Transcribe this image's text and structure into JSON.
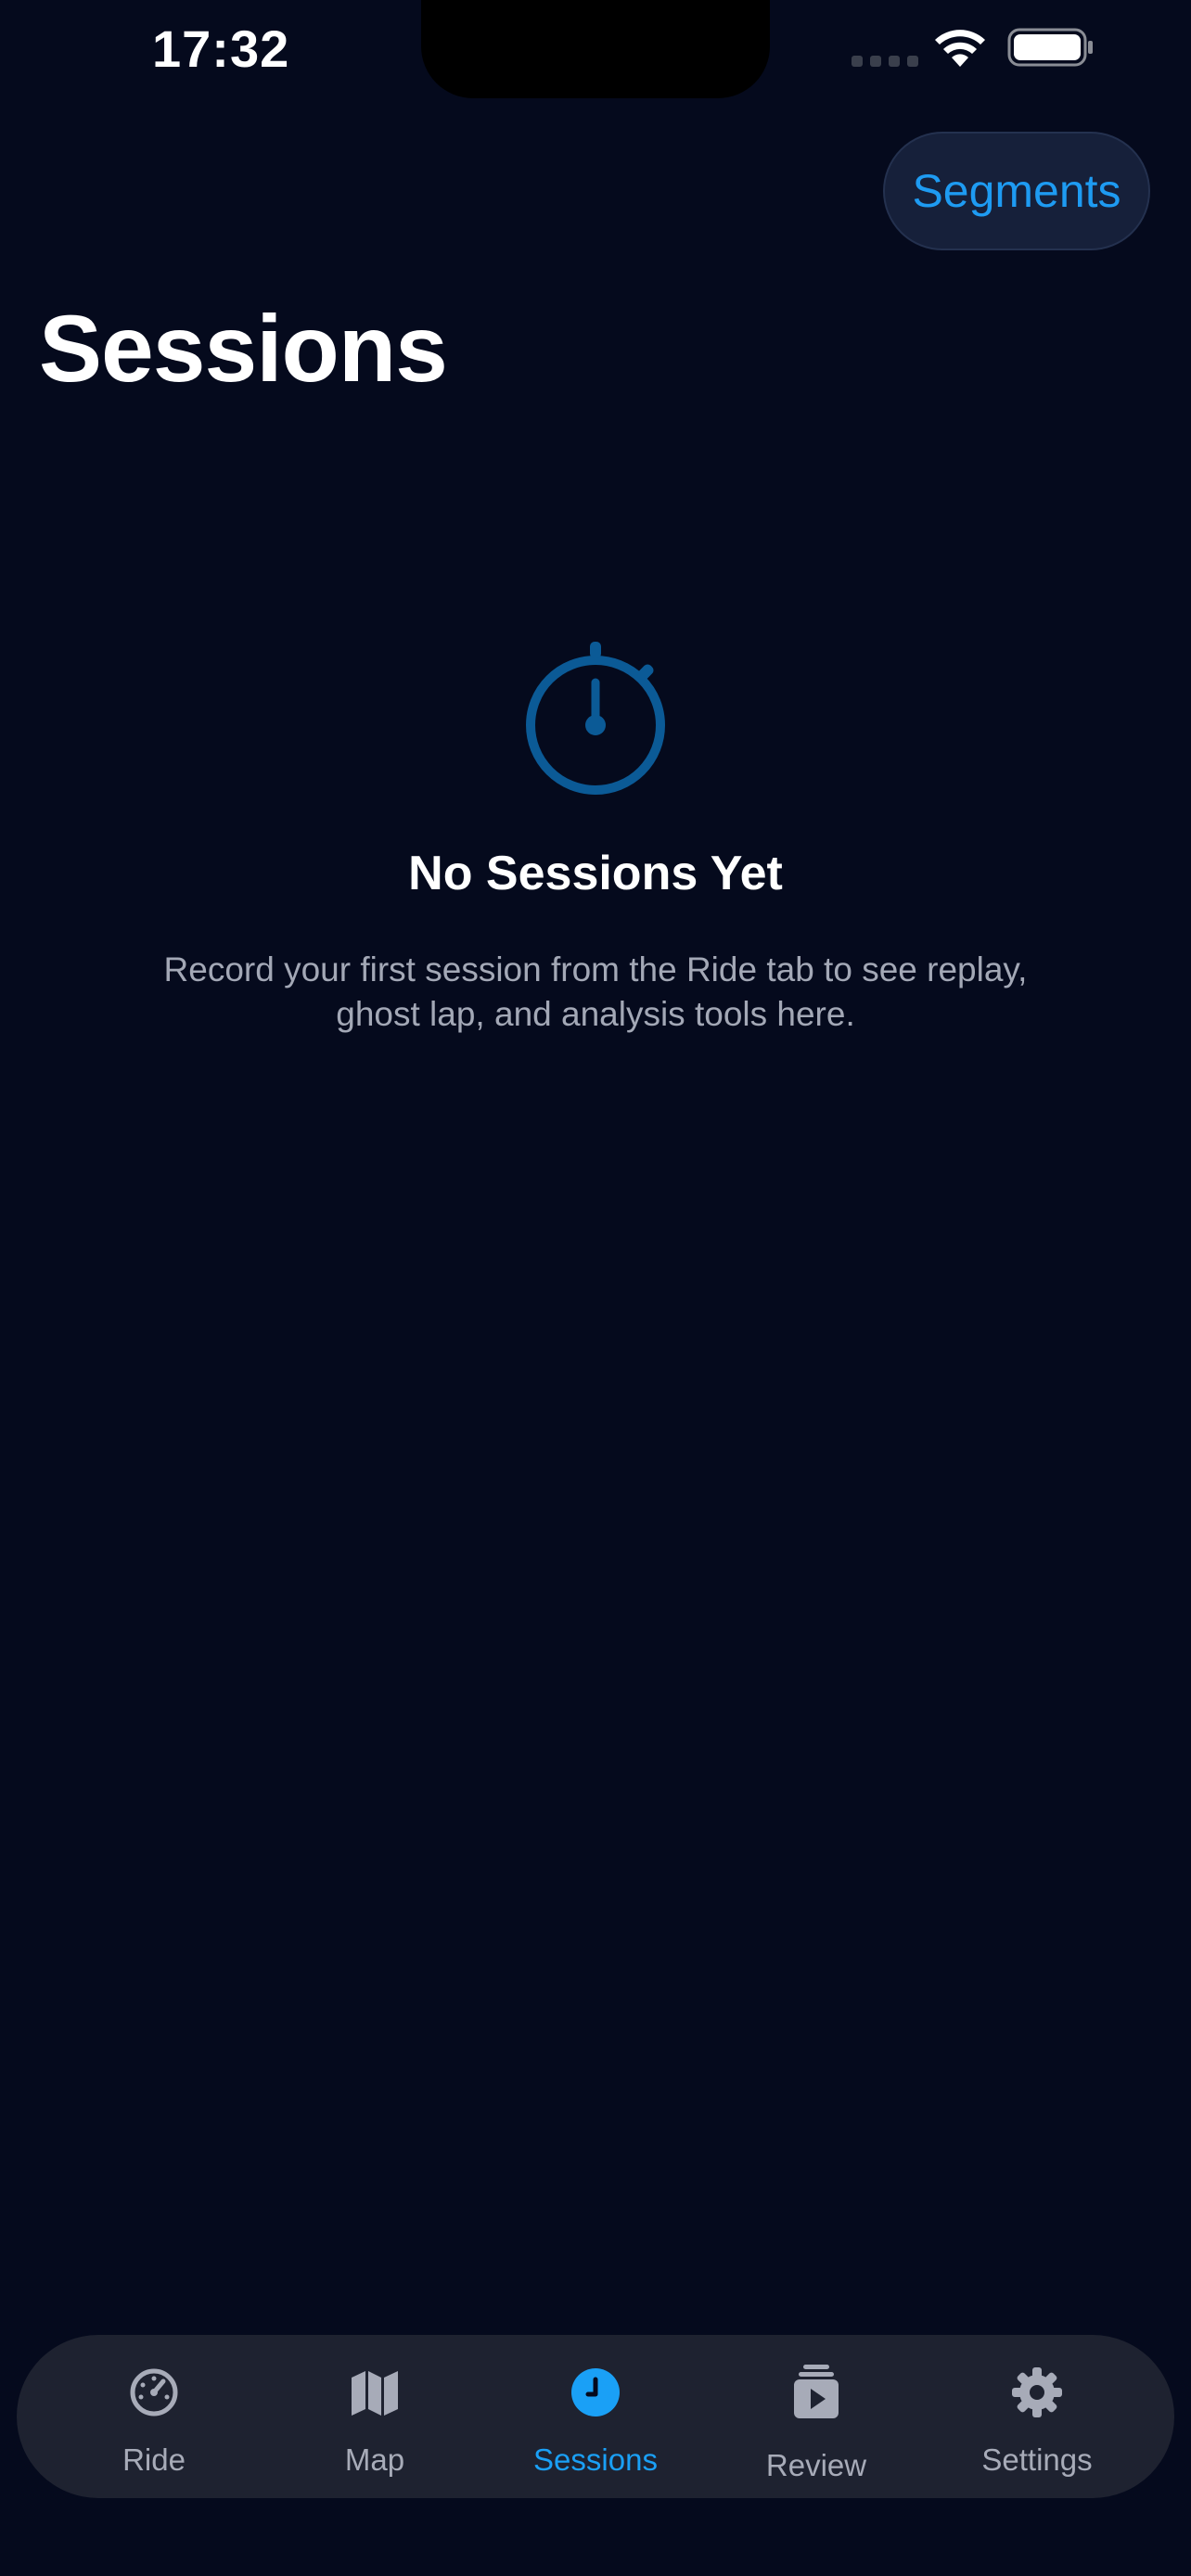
{
  "status_bar": {
    "time": "17:32"
  },
  "header": {
    "segments_label": "Segments",
    "title": "Sessions"
  },
  "empty_state": {
    "icon": "stopwatch-icon",
    "title": "No Sessions Yet",
    "description": "Record your first session from the Ride tab to see replay, ghost lap, and analysis tools here."
  },
  "tab_bar": {
    "items": [
      {
        "label": "Ride",
        "icon": "speedometer-icon",
        "active": false
      },
      {
        "label": "Map",
        "icon": "map-icon",
        "active": false
      },
      {
        "label": "Sessions",
        "icon": "clock-icon",
        "active": true
      },
      {
        "label": "Review",
        "icon": "play-stack-icon",
        "active": false
      },
      {
        "label": "Settings",
        "icon": "gear-icon",
        "active": false
      }
    ]
  },
  "colors": {
    "background": "#050a1d",
    "accent": "#1aa0f6",
    "tab_bar": "#1e2230",
    "icon_muted": "#0b5a96",
    "secondary_text": "#a3a8b6"
  }
}
